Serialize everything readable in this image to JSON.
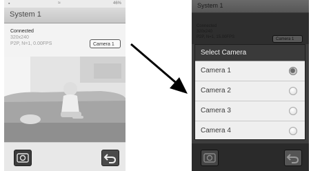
{
  "left": {
    "status": {
      "time": "",
      "wifi_glyph": "↑↓",
      "battery_text": "46%"
    },
    "title": "System 1",
    "info": {
      "status": "Connected",
      "resolution": "320x240",
      "stats": "P2P, N=1, 0.00FPS"
    },
    "camera_select": "Camera 1"
  },
  "right": {
    "title": "System 1",
    "info": {
      "status": "Connected",
      "resolution": "320x240",
      "stats": "P2P, N=1, 15.00FPS"
    },
    "camera_select": "Camera 1",
    "dialog": {
      "title": "Select Camera",
      "options": [
        {
          "label": "Camera 1",
          "selected": true
        },
        {
          "label": "Camera 2",
          "selected": false
        },
        {
          "label": "Camera 3",
          "selected": false
        },
        {
          "label": "Camera 4",
          "selected": false
        }
      ]
    }
  },
  "icons": {
    "snapshot": "camera-snapshot-icon",
    "back": "back-arrow-icon",
    "radio_on": "radio-selected-icon",
    "radio_off": "radio-unselected-icon"
  },
  "colors": {
    "dialog_header": "#3a3a3a",
    "dialog_body": "#efefef",
    "overlay": "#2e2e2e"
  }
}
